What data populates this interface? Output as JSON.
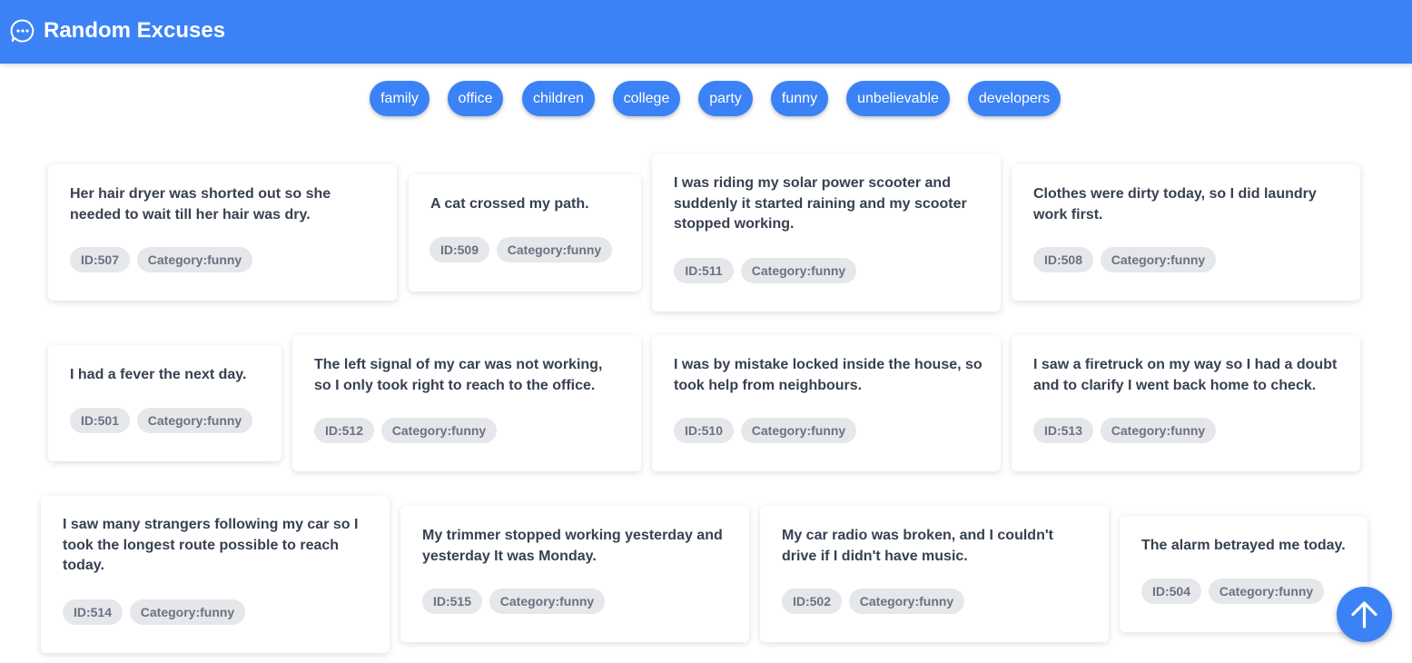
{
  "app": {
    "title": "Random Excuses",
    "icon": "chat-bubble-dots-icon"
  },
  "categories": [
    "family",
    "office",
    "children",
    "college",
    "party",
    "funny",
    "unbelievable",
    "developers"
  ],
  "cards": [
    {
      "text": "Her hair dryer was shorted out so she needed to wait till her hair was dry.",
      "id": "ID:507",
      "category": "Category:funny"
    },
    {
      "text": "A cat crossed my path.",
      "id": "ID:509",
      "category": "Category:funny"
    },
    {
      "text": "I was riding my solar power scooter and suddenly it started raining and my scooter stopped working.",
      "id": "ID:511",
      "category": "Category:funny"
    },
    {
      "text": "Clothes were dirty today, so I did laundry work first.",
      "id": "ID:508",
      "category": "Category:funny"
    },
    {
      "text": "I had a fever the next day.",
      "id": "ID:501",
      "category": "Category:funny"
    },
    {
      "text": "The left signal of my car was not working, so I only took right to reach to the office.",
      "id": "ID:512",
      "category": "Category:funny"
    },
    {
      "text": "I was by mistake locked inside the house, so took help from neighbours.",
      "id": "ID:510",
      "category": "Category:funny"
    },
    {
      "text": "I saw a firetruck on my way so I had a doubt and to clarify I went back home to check.",
      "id": "ID:513",
      "category": "Category:funny"
    },
    {
      "text": "I saw many strangers following my car so I took the longest route possible to reach today.",
      "id": "ID:514",
      "category": "Category:funny"
    },
    {
      "text": "My trimmer stopped working yesterday and yesterday It was Monday.",
      "id": "ID:515",
      "category": "Category:funny"
    },
    {
      "text": "My car radio was broken, and I couldn't drive if I didn't have music.",
      "id": "ID:502",
      "category": "Category:funny"
    },
    {
      "text": "The alarm betrayed me today.",
      "id": "ID:504",
      "category": "Category:funny"
    }
  ],
  "scroll_top": {
    "icon": "arrow-up-icon"
  },
  "colors": {
    "primary": "#3b82f6",
    "badge_bg": "#e5e7eb",
    "badge_text": "#6b7280",
    "card_text": "#374151"
  }
}
